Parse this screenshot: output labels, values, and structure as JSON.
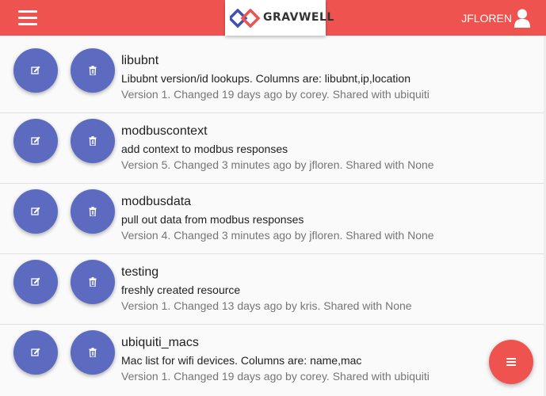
{
  "header": {
    "brand": "GRAVWELL",
    "username": "JFLOREN",
    "accent_color": "#ef5350",
    "icons": {
      "menu": "hamburger-icon",
      "user": "user-icon"
    }
  },
  "resources": [
    {
      "name": "libubnt",
      "description": "Libubnt version/id lookups. Columns are: libubnt,ip,location",
      "meta": "Version 1. Changed 19 days ago by corey. Shared with ubiquiti"
    },
    {
      "name": "modbuscontext",
      "description": "add context to modbus responses",
      "meta": "Version 5. Changed 3 minutes ago by jfloren. Shared with None"
    },
    {
      "name": "modbusdata",
      "description": "pull out data from modbus responses",
      "meta": "Version 4. Changed 3 minutes ago by jfloren. Shared with None"
    },
    {
      "name": "testing",
      "description": "freshly created resource",
      "meta": "Version 1. Changed 13 days ago by kris. Shared with None"
    },
    {
      "name": "ubiquiti_macs",
      "description": "Mac list for wifi devices. Columns are: name,mac",
      "meta": "Version 1. Changed 19 days ago by corey. Shared with ubiquiti"
    }
  ],
  "row_actions": {
    "edit_icon": "edit-icon",
    "delete_icon": "trash-icon",
    "button_color": "#5c6bc0"
  },
  "fab": {
    "icon": "menu-icon",
    "color": "#ef5350"
  }
}
